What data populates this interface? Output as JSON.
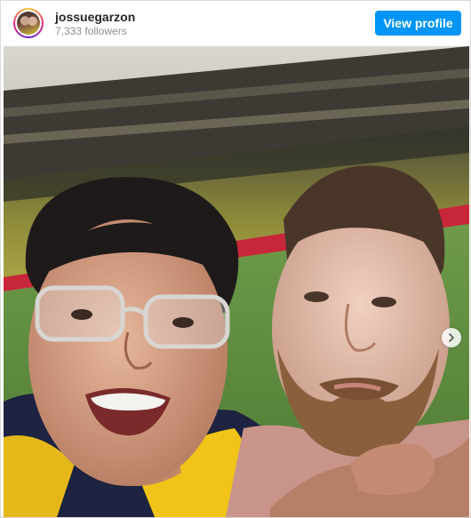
{
  "post": {
    "username": "jossuegarzon",
    "followers": "7,333 followers",
    "view_profile_label": "View profile"
  },
  "media": {
    "description_icon": "selfie-photo",
    "carousel_next_icon": "chevron-right-icon"
  },
  "colors": {
    "button": "#0095f6",
    "username": "#262626",
    "muted": "#8e8e8e"
  }
}
